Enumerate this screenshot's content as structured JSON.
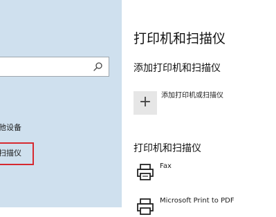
{
  "sidebar": {
    "search": {
      "value": "",
      "placeholder": ""
    },
    "items": [
      {
        "label": "他设备"
      },
      {
        "label": "扫描仪"
      }
    ]
  },
  "main": {
    "title": "打印机和扫描仪",
    "add_section": {
      "title": "添加打印机和扫描仪",
      "add_icon": "+",
      "add_label": "添加打印机或扫描仪"
    },
    "list_section": {
      "title": "打印机和扫描仪",
      "printers": [
        {
          "name": "Fax",
          "icon": "printer-icon"
        },
        {
          "name": "Microsoft Print to PDF",
          "icon": "printer-icon"
        }
      ]
    }
  },
  "colors": {
    "sidebar_bg": "#cfe0ee",
    "selected_outline": "#d6282f",
    "add_button_bg": "#e6e6e6"
  }
}
